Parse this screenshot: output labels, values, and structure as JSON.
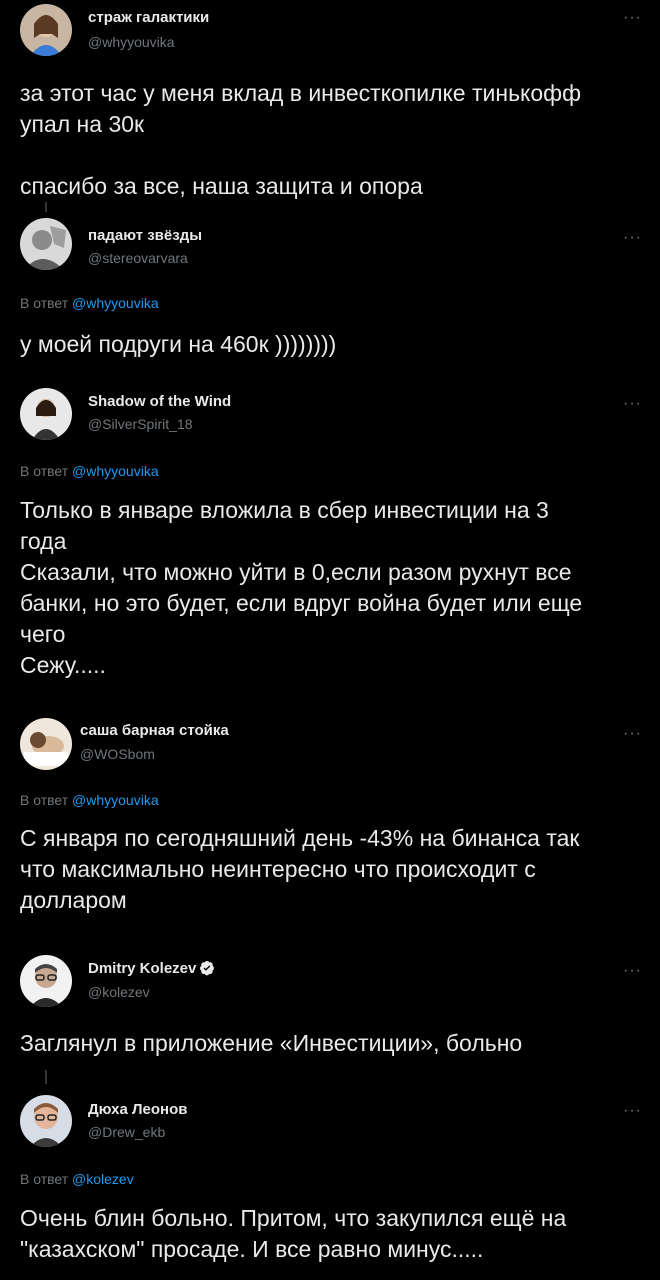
{
  "reply_prefix": "В ответ",
  "colors": {
    "background": "#000000",
    "text": "#e7e9ea",
    "secondary": "#71767b",
    "accent": "#1d9bf0"
  },
  "tweets": [
    {
      "name": "страж галактики",
      "handle": "@whyyouvika",
      "text": "за этот час у меня вклад в инвесткопилке тинькофф\nупал на 30к\n\nспасибо за все, наша защита и опора"
    },
    {
      "name": "падают звёзды",
      "handle": "@stereovarvara",
      "reply_to": "@whyyouvika",
      "text": "у моей подруги на 460к ))))))))"
    },
    {
      "name": "Shadow of the Wind",
      "handle": "@SilverSpirit_18",
      "reply_to": "@whyyouvika",
      "text": "Только в январе вложила в сбер инвестиции на 3\nгода\nСказали, что можно уйти в 0,если разом рухнут все\nбанки, но это будет, если вдруг война будет или еще\nчего\nСежу....."
    },
    {
      "name": "саша барная стойка",
      "handle": "@WOSbom",
      "reply_to": "@whyyouvika",
      "text": "С января по сегодняшний день -43% на бинанса так\nчто максимально неинтересно что происходит с\nдолларом"
    },
    {
      "name": "Dmitry Kolezev",
      "handle": "@kolezev",
      "verified": true,
      "text": "Заглянул в приложение «Инвестиции», больно"
    },
    {
      "name": "Дюха Леонов",
      "handle": "@Drew_ekb",
      "reply_to": "@kolezev",
      "text": "Очень блин больно. Притом, что закупился ещё на\n\"казахском\" просаде. И все равно минус....."
    }
  ],
  "icons": {
    "more": "more-horizontal-icon",
    "verified": "verified-badge-icon"
  }
}
